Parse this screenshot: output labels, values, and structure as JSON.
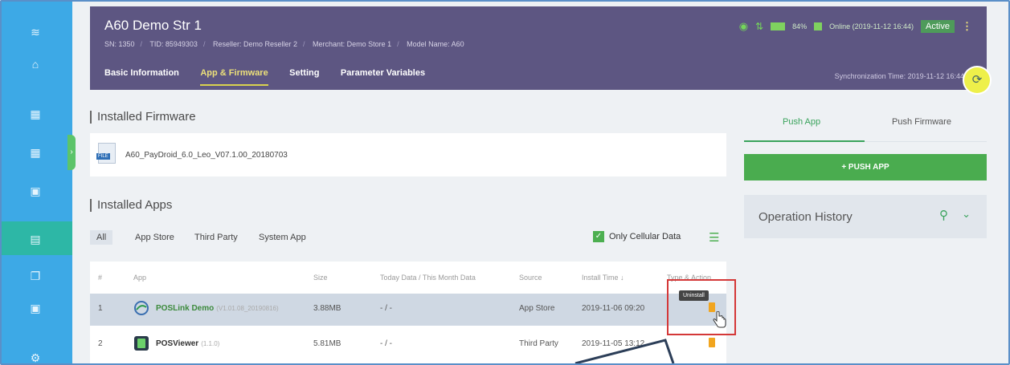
{
  "device": {
    "title": "A60 Demo Str 1",
    "meta": [
      "SN: 1350",
      "TID: 85949303",
      "Reseller: Demo Reseller 2",
      "Merchant: Demo Store 1",
      "Model Name: A60"
    ],
    "battery": "84%",
    "online": "Online (2019-11-12 16:44)",
    "status_badge": "Active",
    "sync_time": "Synchronization Time: 2019-11-12 16:44"
  },
  "tabs": [
    {
      "label": "Basic Information",
      "active": false
    },
    {
      "label": "App & Firmware",
      "active": true
    },
    {
      "label": "Setting",
      "active": false
    },
    {
      "label": "Parameter Variables",
      "active": false
    }
  ],
  "firmware": {
    "section_title": "Installed Firmware",
    "name": "A60_PayDroid_6.0_Leo_V07.1.00_20180703",
    "icon_label": "FILE"
  },
  "apps": {
    "section_title": "Installed Apps",
    "filters": [
      "All",
      "App Store",
      "Third Party",
      "System App"
    ],
    "active_filter": "All",
    "only_cellular_label": "Only Cellular Data",
    "only_cellular_checked": true,
    "columns": [
      "#",
      "App",
      "Size",
      "Today Data / This Month Data",
      "Source",
      "Install Time ↓",
      "Type & Action"
    ],
    "rows": [
      {
        "index": "1",
        "name": "POSLink Demo",
        "version": "(V1.01.08_20190816)",
        "size": "3.88MB",
        "data": "- / -",
        "source": "App Store",
        "install_time": "2019-11-06 09:20"
      },
      {
        "index": "2",
        "name": "POSViewer",
        "version": "(1.1.0)",
        "size": "5.81MB",
        "data": "- / -",
        "source": "Third Party",
        "install_time": "2019-11-05 13:12"
      }
    ],
    "tooltip": "Uninstall"
  },
  "right_panel": {
    "tabs": [
      "Push App",
      "Push Firmware"
    ],
    "active_tab": "Push App",
    "push_button": "+ PUSH APP",
    "operation_history": "Operation History"
  },
  "colors": {
    "header": "#5d5682",
    "sidebar": "#3da9e6",
    "accent_green": "#4aac4f",
    "highlight_red": "#d43838",
    "delete_orange": "#f1a51f"
  }
}
